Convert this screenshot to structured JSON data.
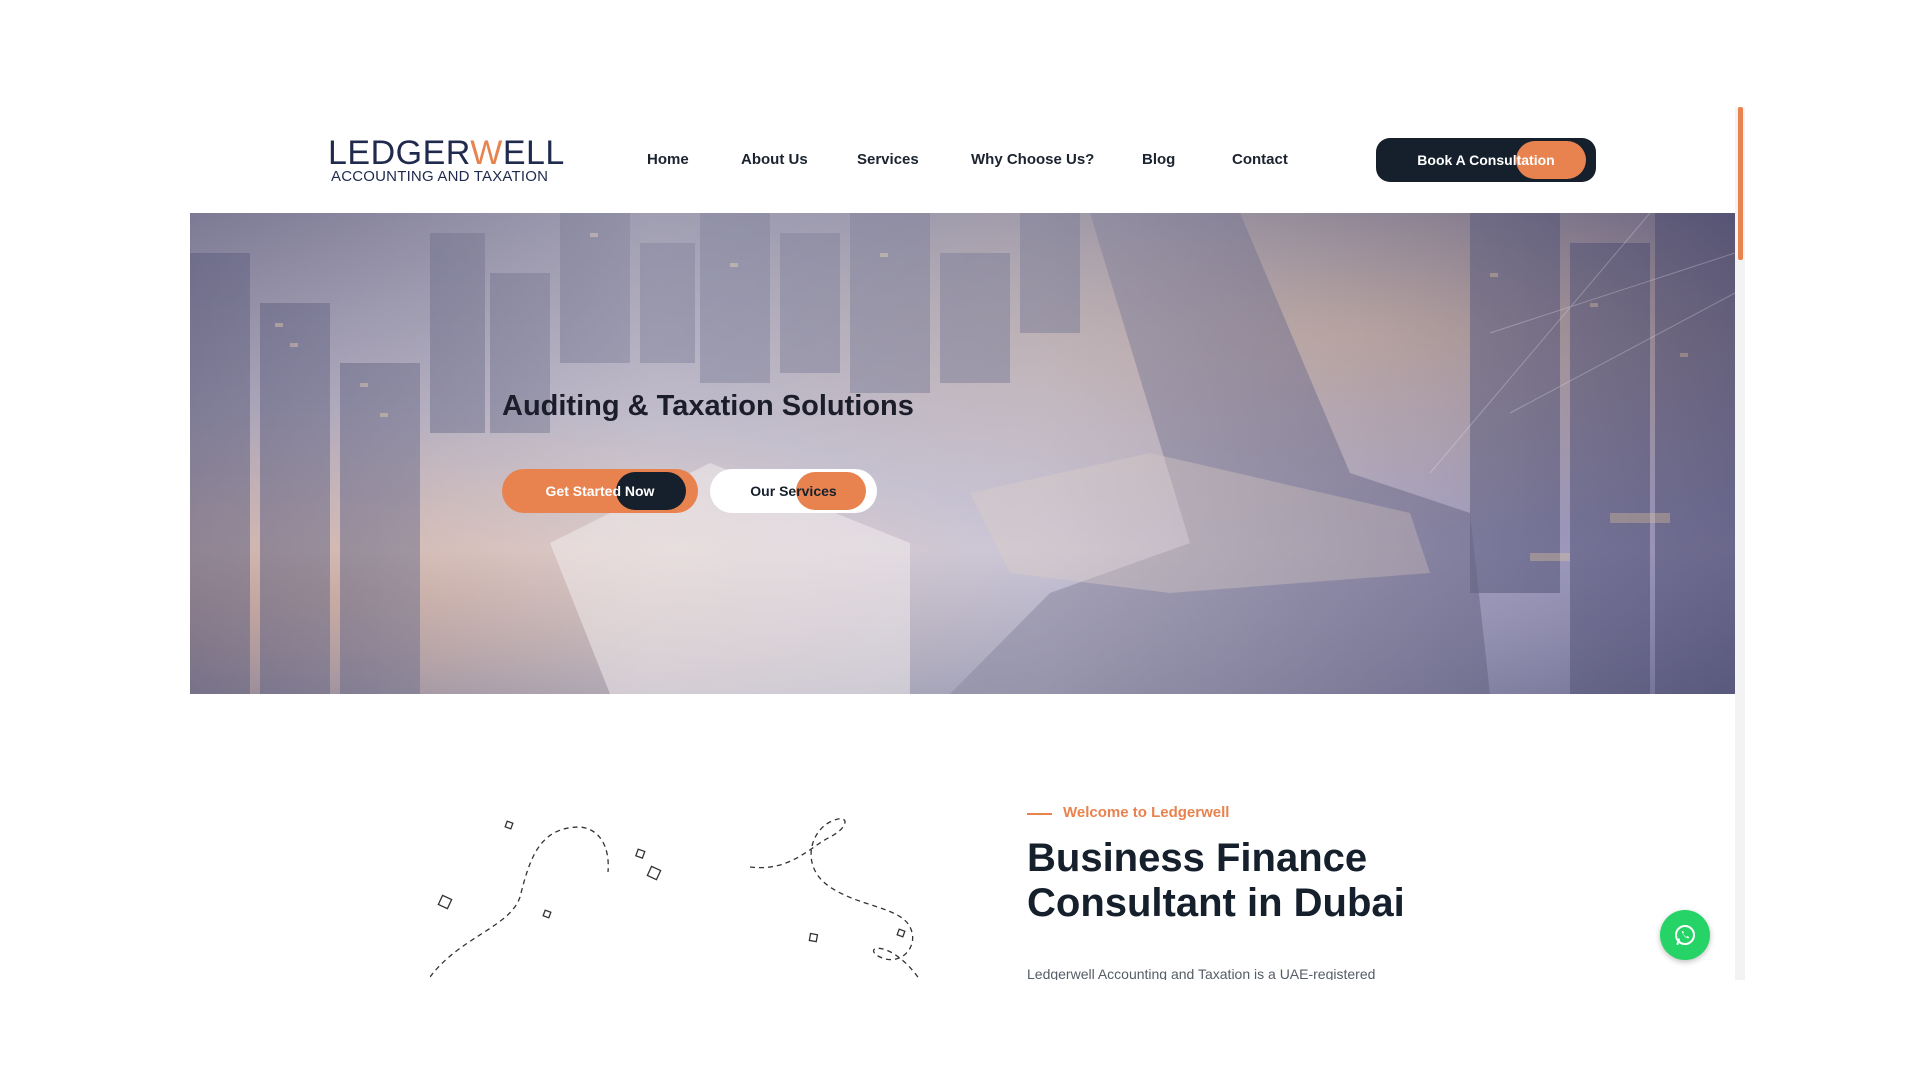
{
  "brand": {
    "logo_prefix": "LEDGER",
    "logo_w": "W",
    "logo_suffix": "ELL",
    "tagline": "ACCOUNTING AND TAXATION",
    "accent_color": "#e8834f",
    "dark_color": "#16202c"
  },
  "nav": {
    "items": [
      "Home",
      "About Us",
      "Services",
      "Why Choose Us?",
      "Blog",
      "Contact"
    ],
    "cta_label": "Book A Consultation"
  },
  "hero": {
    "title": "Auditing & Taxation Solutions",
    "primary_button": "Get Started Now",
    "secondary_button": "Our Services"
  },
  "welcome": {
    "kicker": "Welcome to Ledgerwell",
    "title_line1": "Business Finance",
    "title_line2": "Consultant in Dubai",
    "body": "Ledgerwell Accounting and Taxation is a UAE-registered"
  },
  "floating": {
    "whatsapp_icon": "whatsapp-icon"
  }
}
